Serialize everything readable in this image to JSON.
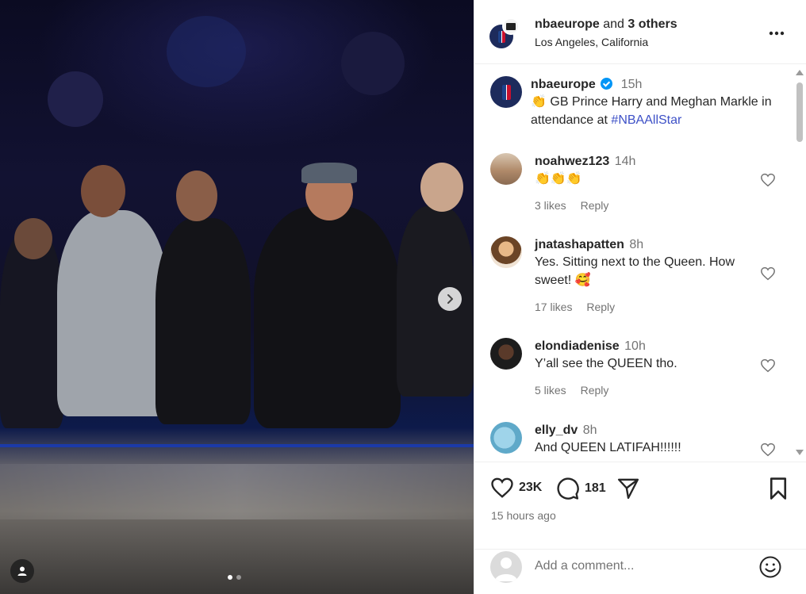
{
  "post": {
    "header": {
      "username": "nbaeurope",
      "and_text": "and",
      "others": "3 others",
      "location": "Los Angeles, California",
      "more_icon": "more-horizontal-icon"
    },
    "caption": {
      "username": "nbaeurope",
      "time": "15h",
      "text_prefix": "👏 GB Prince Harry and Meghan Markle in attendance at ",
      "hashtag": "#NBAAllStar"
    },
    "comments": [
      {
        "username": "noahwez123",
        "time": "14h",
        "text": "👏👏👏",
        "likes": "3 likes",
        "reply": "Reply"
      },
      {
        "username": "jnatashapatten",
        "time": "8h",
        "text": "Yes. Sitting next to the Queen. How sweet! 🥰",
        "likes": "17 likes",
        "reply": "Reply"
      },
      {
        "username": "elondiadenise",
        "time": "10h",
        "text": "Y’all see the QUEEN tho.",
        "likes": "5 likes",
        "reply": "Reply"
      },
      {
        "username": "elly_dv",
        "time": "8h",
        "text": "And QUEEN LATIFAH!!!!!!",
        "likes": "",
        "reply": ""
      }
    ],
    "actions": {
      "likes_count": "23K",
      "comments_count": "181",
      "time_ago": "15 hours ago"
    },
    "add_comment": {
      "placeholder": "Add a comment..."
    },
    "media": {
      "slide_count": 2,
      "active_slide": 1
    },
    "colors": {
      "hashtag": "#3e51c7",
      "verified": "#0095f6",
      "muted": "#737373",
      "text": "#262626"
    }
  }
}
